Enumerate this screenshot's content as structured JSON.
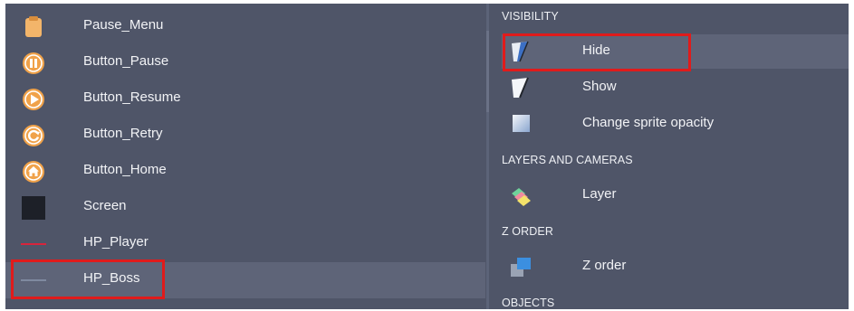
{
  "objects_panel": {
    "items": [
      {
        "label": "Pause_Menu",
        "icon": "clipboard-icon"
      },
      {
        "label": "Button_Pause",
        "icon": "pause-icon"
      },
      {
        "label": "Button_Resume",
        "icon": "play-icon"
      },
      {
        "label": "Button_Retry",
        "icon": "retry-icon"
      },
      {
        "label": "Button_Home",
        "icon": "home-icon"
      },
      {
        "label": "Screen",
        "icon": "black-square-icon"
      },
      {
        "label": "HP_Player",
        "icon": "red-line-icon"
      },
      {
        "label": "HP_Boss",
        "icon": "gray-line-icon"
      }
    ],
    "selected": "HP_Boss"
  },
  "actions_panel": {
    "sections": {
      "visibility": "VISIBILITY",
      "layers_and_cameras": "LAYERS AND CAMERAS",
      "z_order": "Z ORDER",
      "objects": "OBJECTS"
    },
    "actions": {
      "hide": "Hide",
      "show": "Show",
      "change_sprite_opacity": "Change sprite opacity",
      "layer": "Layer",
      "z_order": "Z order"
    },
    "selected": "Hide"
  },
  "colors": {
    "panel_bg": "#4f5568",
    "selected_bg": "#5e6478",
    "highlight": "#e01b1b",
    "icon_orange": "#f0a24a"
  }
}
